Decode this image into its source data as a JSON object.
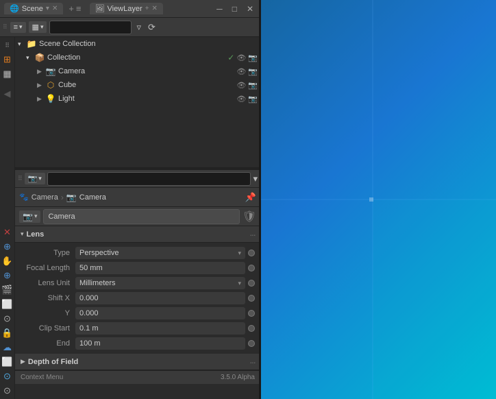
{
  "window": {
    "title": "Scene",
    "tabs": [
      {
        "label": "Scene",
        "active": true
      },
      {
        "label": "ViewLayer",
        "active": false
      }
    ],
    "controls": [
      "minimize",
      "maximize",
      "close"
    ]
  },
  "outliner": {
    "header": {
      "view_label": "☰",
      "search_placeholder": "",
      "filter_icon": "filter",
      "sync_icon": "sync"
    },
    "items": [
      {
        "id": "scene-collection",
        "label": "Scene Collection",
        "level": 0,
        "icon": "📁",
        "expanded": true
      },
      {
        "id": "collection",
        "label": "Collection",
        "level": 1,
        "icon": "📦",
        "expanded": true,
        "has_checkbox": true
      },
      {
        "id": "camera",
        "label": "Camera",
        "level": 2,
        "icon": "📷",
        "type": "camera"
      },
      {
        "id": "cube",
        "label": "Cube",
        "level": 2,
        "icon": "⬡",
        "type": "mesh"
      },
      {
        "id": "light",
        "label": "Light",
        "level": 2,
        "icon": "💡",
        "type": "light"
      }
    ]
  },
  "properties": {
    "breadcrumb": {
      "icon": "📷",
      "path": [
        "Camera",
        "Camera"
      ]
    },
    "object_name": "Camera",
    "sections": {
      "lens": {
        "title": "Lens",
        "fields": [
          {
            "label": "Type",
            "value": "Perspective",
            "type": "dropdown"
          },
          {
            "label": "Focal Length",
            "value": "50 mm",
            "type": "number"
          },
          {
            "label": "Lens Unit",
            "value": "Millimeters",
            "type": "dropdown"
          },
          {
            "label": "Shift X",
            "value": "0.000",
            "type": "number"
          },
          {
            "label": "Y",
            "value": "0.000",
            "type": "number"
          },
          {
            "label": "Clip Start",
            "value": "0.1 m",
            "type": "number"
          },
          {
            "label": "End",
            "value": "100 m",
            "type": "number"
          }
        ]
      },
      "depth_of_field": {
        "title": "Depth of Field"
      }
    }
  },
  "left_toolbar": {
    "icons": [
      "⊞",
      "↕",
      "⊙",
      "✕",
      "⋮",
      "☻",
      "✋",
      "⊕",
      "🎬",
      "⬜",
      "⊙",
      "🔒",
      "☁",
      "⬜",
      "⊙"
    ]
  },
  "status_bar": {
    "left": "Context Menu",
    "version": "3.5.0 Alpha"
  }
}
